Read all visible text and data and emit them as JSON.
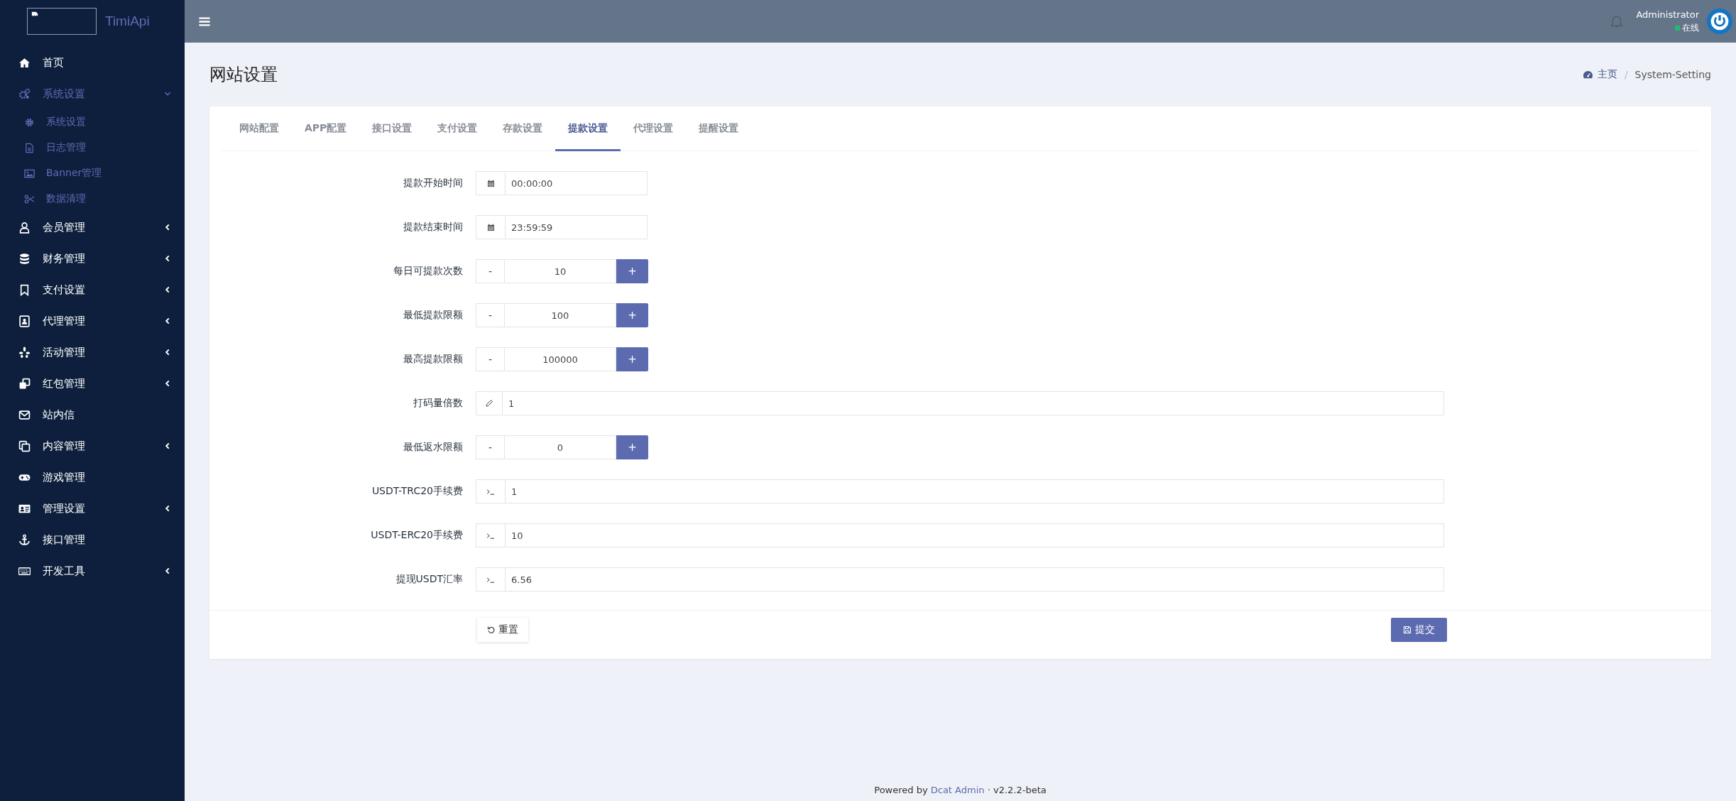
{
  "brand": {
    "name": "TimiApi"
  },
  "sidebar": {
    "items": [
      {
        "label": "首页"
      },
      {
        "label": "系统设置",
        "expanded": true,
        "children": [
          {
            "label": "系统设置"
          },
          {
            "label": "日志管理"
          },
          {
            "label": "Banner管理"
          },
          {
            "label": "数据清理"
          }
        ]
      },
      {
        "label": "会员管理",
        "expanded": false
      },
      {
        "label": "财务管理",
        "expanded": false
      },
      {
        "label": "支付设置",
        "expanded": false
      },
      {
        "label": "代理管理",
        "expanded": false
      },
      {
        "label": "活动管理",
        "expanded": false
      },
      {
        "label": "红包管理",
        "expanded": false
      },
      {
        "label": "站内信"
      },
      {
        "label": "内容管理",
        "expanded": false
      },
      {
        "label": "游戏管理"
      },
      {
        "label": "管理设置",
        "expanded": false
      },
      {
        "label": "接口管理"
      },
      {
        "label": "开发工具",
        "expanded": false
      }
    ]
  },
  "header": {
    "user": "Administrator",
    "status": "在线",
    "online": true
  },
  "page": {
    "title": "网站设置",
    "breadcrumb": [
      "主页",
      "System-Setting"
    ],
    "breadcrumb_separator": "/"
  },
  "tabs": [
    {
      "label": "网站配置",
      "selected": false
    },
    {
      "label": "APP配置",
      "selected": false
    },
    {
      "label": "接口设置",
      "selected": false
    },
    {
      "label": "支付设置",
      "selected": false
    },
    {
      "label": "存款设置",
      "selected": false
    },
    {
      "label": "提款设置",
      "selected": true
    },
    {
      "label": "代理设置",
      "selected": false
    },
    {
      "label": "提醒设置",
      "selected": false
    }
  ],
  "fields": [
    {
      "label": "提款开始时间",
      "kind": "time",
      "value": "00:00:00"
    },
    {
      "label": "提款结束时间",
      "kind": "time",
      "value": "23:59:59"
    },
    {
      "label": "每日可提款次数",
      "kind": "stepper",
      "value": "10",
      "minus": "-",
      "plus": "+"
    },
    {
      "label": "最低提款限额",
      "kind": "stepper",
      "value": "100",
      "minus": "-",
      "plus": "+"
    },
    {
      "label": "最高提款限额",
      "kind": "stepper",
      "value": "100000",
      "minus": "-",
      "plus": "+"
    },
    {
      "label": "打码量倍数",
      "kind": "pencil",
      "value": "1"
    },
    {
      "label": "最低返水限额",
      "kind": "stepper",
      "value": "0",
      "minus": "-",
      "plus": "+"
    },
    {
      "label": "USDT-TRC20手续费",
      "kind": "terminal",
      "value": "1"
    },
    {
      "label": "USDT-ERC20手续费",
      "kind": "terminal",
      "value": "10"
    },
    {
      "label": "提现USDT汇率",
      "kind": "terminal",
      "value": "6.56"
    }
  ],
  "actions": {
    "reset": "重置",
    "submit": "提交"
  },
  "footer": {
    "prefix": "Powered by",
    "link": "Dcat Admin",
    "separator": "·",
    "version": "v2.2.2-beta"
  }
}
